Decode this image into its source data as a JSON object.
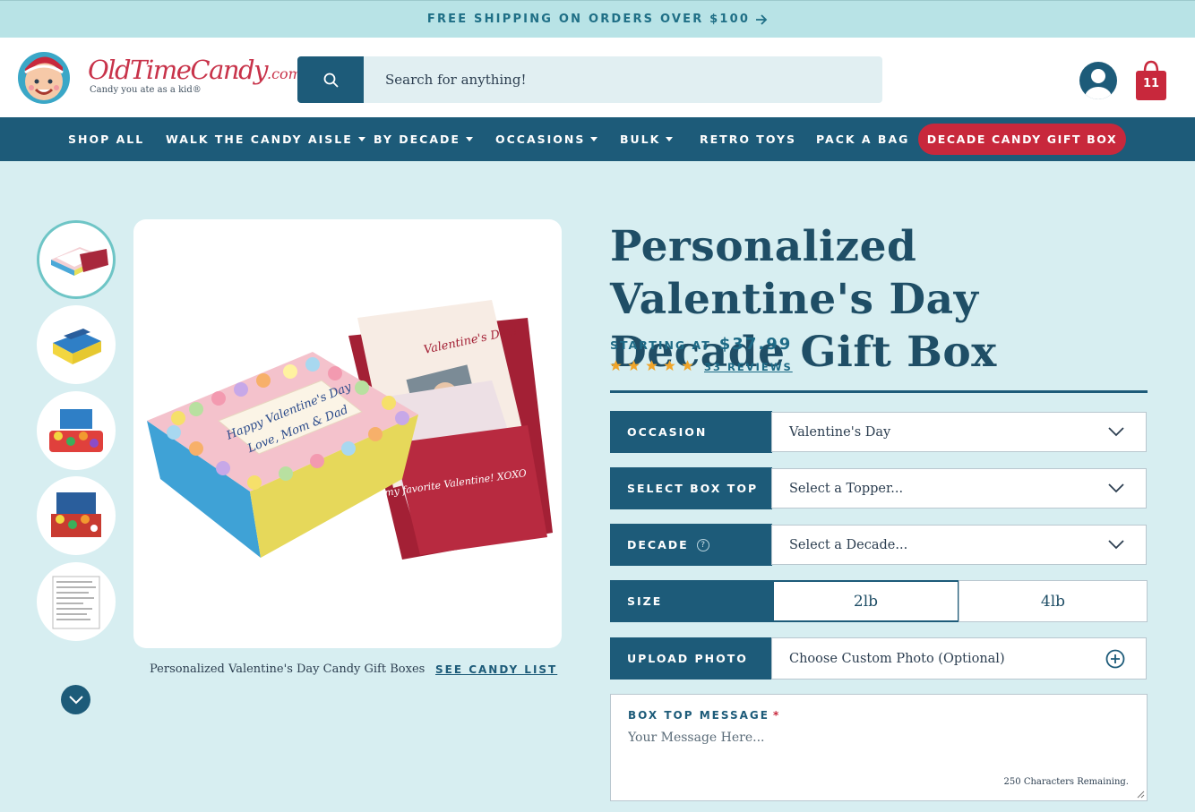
{
  "promo": {
    "text": "FREE SHIPPING ON ORDERS OVER $100"
  },
  "header": {
    "logo_text": "OldTimeCandy",
    "logo_suffix": ".com",
    "logo_tagline": "Candy you ate as a kid®",
    "search_placeholder": "Search for anything!",
    "cart_count": "11"
  },
  "nav": {
    "items": [
      {
        "label": "SHOP ALL"
      },
      {
        "label": "WALK THE CANDY AISLE"
      },
      {
        "label": "BY DECADE"
      },
      {
        "label": "OCCASIONS"
      },
      {
        "label": "BULK"
      },
      {
        "label": "RETRO TOYS"
      },
      {
        "label": "PACK A BAG"
      }
    ],
    "cta": "DECADE CANDY GIFT BOX"
  },
  "gallery": {
    "caption": "Personalized Valentine's Day Candy Gift Boxes",
    "candy_list_link": "SEE CANDY LIST"
  },
  "product": {
    "title": "Personalized Valentine's Day Decade Gift Box",
    "starting_label": "STARTING AT",
    "price": "$37.99",
    "rating": 5,
    "reviews": "33 REVIEWS"
  },
  "options": {
    "occasion": {
      "label": "OCCASION",
      "value": "Valentine's Day"
    },
    "box_top": {
      "label": "SELECT BOX TOP",
      "value": "Select a Topper..."
    },
    "decade": {
      "label": "DECADE",
      "value": "Select a Decade...",
      "help": "?"
    },
    "size": {
      "label": "SIZE",
      "choices": [
        "2lb",
        "4lb"
      ]
    },
    "upload": {
      "label": "UPLOAD PHOTO",
      "value": "Choose Custom Photo (Optional)"
    }
  },
  "message": {
    "label": "BOX TOP MESSAGE",
    "required_mark": "*",
    "placeholder": "Your Message Here...",
    "remaining": "250 Characters Remaining."
  },
  "box_art": {
    "line1": "Happy Valentine's Day",
    "line2": "Love, Mom & Dad",
    "card_text": "my favorite Valentine! XOXO",
    "card_title": "Valentine's Day!"
  },
  "colors": {
    "navy": "#1d5b79",
    "red": "#c8283c",
    "teal_bg": "#d7eef1",
    "star": "#f0a52a"
  }
}
